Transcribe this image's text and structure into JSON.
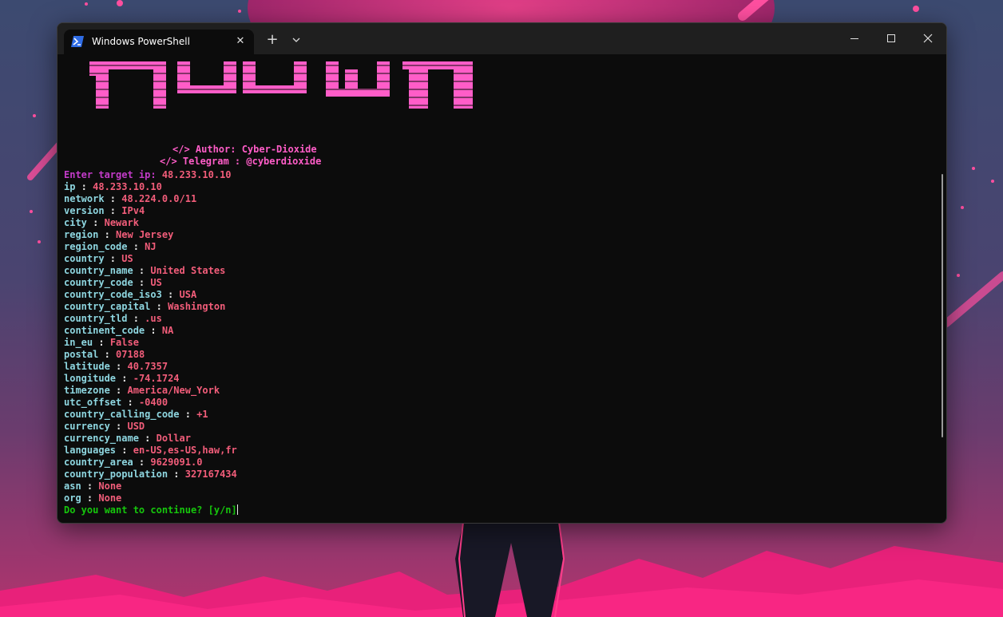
{
  "window": {
    "tab_title": "Windows PowerShell",
    "new_tab_label": "+",
    "close_tab_label": "✕"
  },
  "banner": {
    "author_line": "</> Author: Cyber-Dioxide",
    "telegram_line": "</> Telegram : @cyberdioxide",
    "color": "#ff5dc8"
  },
  "prompt": {
    "label": "Enter target ip: ",
    "value": "48.233.10.10"
  },
  "fields": [
    {
      "key": "ip",
      "value": "48.233.10.10"
    },
    {
      "key": "network",
      "value": "48.224.0.0/11"
    },
    {
      "key": "version",
      "value": "IPv4"
    },
    {
      "key": "city",
      "value": "Newark"
    },
    {
      "key": "region",
      "value": "New Jersey"
    },
    {
      "key": "region_code",
      "value": "NJ"
    },
    {
      "key": "country",
      "value": "US"
    },
    {
      "key": "country_name",
      "value": "United States"
    },
    {
      "key": "country_code",
      "value": "US"
    },
    {
      "key": "country_code_iso3",
      "value": "USA"
    },
    {
      "key": "country_capital",
      "value": "Washington"
    },
    {
      "key": "country_tld",
      "value": ".us"
    },
    {
      "key": "continent_code",
      "value": "NA"
    },
    {
      "key": "in_eu",
      "value": "False"
    },
    {
      "key": "postal",
      "value": "07188"
    },
    {
      "key": "latitude",
      "value": "40.7357"
    },
    {
      "key": "longitude",
      "value": "-74.1724"
    },
    {
      "key": "timezone",
      "value": "America/New_York"
    },
    {
      "key": "utc_offset",
      "value": "-0400"
    },
    {
      "key": "country_calling_code",
      "value": "+1"
    },
    {
      "key": "currency",
      "value": "USD"
    },
    {
      "key": "currency_name",
      "value": "Dollar"
    },
    {
      "key": "languages",
      "value": "en-US,es-US,haw,fr"
    },
    {
      "key": "country_area",
      "value": "9629091.0"
    },
    {
      "key": "country_population",
      "value": "327167434"
    },
    {
      "key": "asn",
      "value": "None"
    },
    {
      "key": "org",
      "value": "None"
    }
  ],
  "separator": " : ",
  "continue_prompt": "Do you want to continue? [y/n]",
  "colors": {
    "terminal_bg": "#0c0c0c",
    "key": "#8ed6e0",
    "value": "#f25d7a",
    "prompt": "#c33bc9",
    "green": "#16c60c"
  }
}
